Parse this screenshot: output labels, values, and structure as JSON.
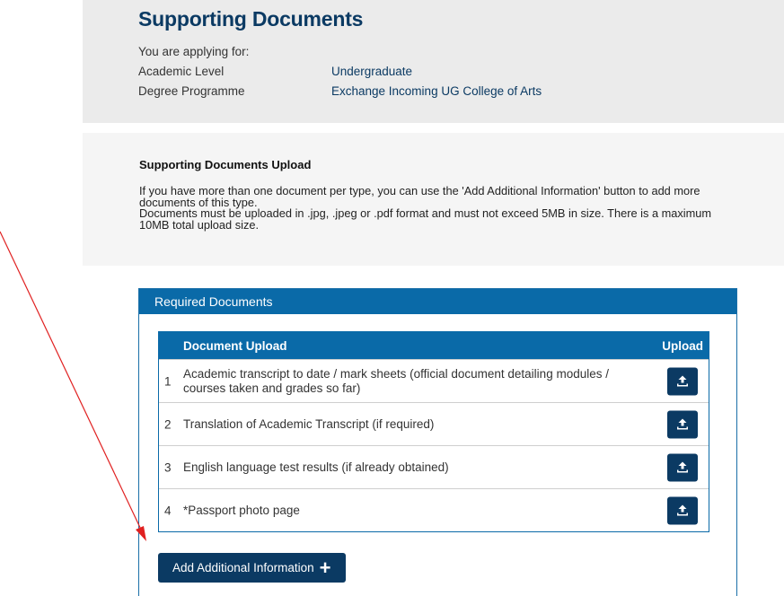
{
  "header": {
    "title": "Supporting Documents",
    "applying_for": "You are applying for:",
    "rows": [
      {
        "label": "Academic Level",
        "value": "Undergraduate"
      },
      {
        "label": "Degree Programme",
        "value": "Exchange Incoming UG College of Arts"
      }
    ]
  },
  "upload_info": {
    "heading": "Supporting Documents Upload",
    "paragraph1": "If you have more than one document per type, you can use the 'Add Additional Information' button to add more documents of this type.",
    "paragraph2": "Documents must be uploaded in .jpg, .jpeg or .pdf format and must not exceed 5MB in size. There is a maximum 10MB total upload size."
  },
  "required_documents": {
    "title": "Required Documents",
    "columns": {
      "document": "Document Upload",
      "upload": "Upload"
    },
    "rows": [
      {
        "num": "1",
        "label": "Academic transcript to date / mark sheets (official document detailing modules / courses taken and grades so far)"
      },
      {
        "num": "2",
        "label": "Translation of Academic Transcript (if required)"
      },
      {
        "num": "3",
        "label": "English language test results (if already obtained)"
      },
      {
        "num": "4",
        "label": "*Passport photo page"
      }
    ],
    "add_button_label": "Add Additional Information",
    "add_button_icon": "+"
  },
  "colors": {
    "title_blue": "#0b3a63",
    "header_bar": "#0a6aa8",
    "annotation_arrow": "#e02020"
  }
}
